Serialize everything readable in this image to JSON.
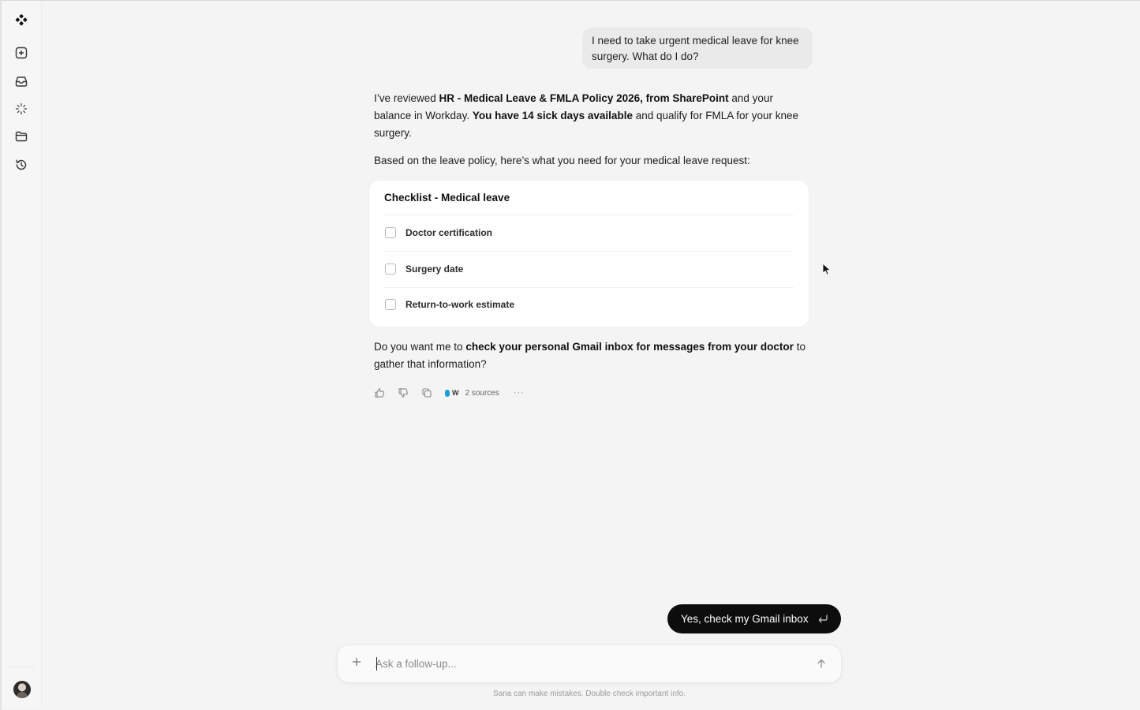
{
  "sidebar": {
    "icons": [
      "logo-icon",
      "new-chat-icon",
      "inbox-icon",
      "loader-icon",
      "folder-icon",
      "history-icon"
    ]
  },
  "conversation": {
    "user_message": "I need to take urgent medical leave for knee surgery. What do I do?",
    "answer": {
      "p1_a": "I’ve reviewed ",
      "p1_b": "HR - Medical Leave & FMLA Policy 2026, from SharePoint",
      "p1_c": " and your balance in Workday. ",
      "p1_d": "You have 14 sick days available",
      "p1_e": " and qualify for FMLA for your knee surgery.",
      "p2": "Based on the leave policy, here’s what you need for your medical leave request:"
    },
    "checklist": {
      "title": "Checklist - Medical leave",
      "items": [
        {
          "label": "Doctor certification",
          "checked": false
        },
        {
          "label": "Surgery date",
          "checked": false
        },
        {
          "label": "Return-to-work estimate",
          "checked": false
        }
      ]
    },
    "question": {
      "a": "Do you want me to ",
      "b": "check your personal Gmail inbox for messages from your doctor",
      "c": " to gather that information?"
    },
    "actions": {
      "sources_label": "2 sources",
      "source_letter": "W",
      "more": "···"
    }
  },
  "suggestion": {
    "label": "Yes, check my Gmail inbox"
  },
  "composer": {
    "placeholder": "Ask a follow-up..."
  },
  "disclaimer": "Sana can make mistakes. Double check important info.",
  "colors": {
    "background": "#f4f4f4",
    "pill": "#0d0d0d",
    "card": "#ffffff"
  }
}
